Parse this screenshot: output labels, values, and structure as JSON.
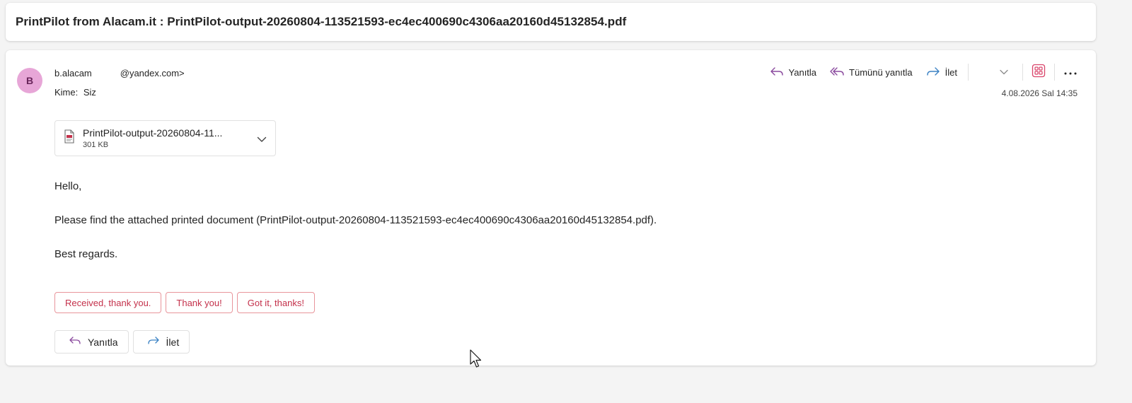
{
  "subject": "PrintPilot from Alacam.it : PrintPilot-output-20260804-113521593-ec4ec400690c4306aa20160d45132854.pdf",
  "sender": {
    "avatar_initial": "B",
    "name_part": "b.alacam",
    "email_part": "@yandex.com>"
  },
  "recipient": {
    "label": "Kime:",
    "value": "Siz"
  },
  "date": "4.08.2026 Sal 14:35",
  "actions": {
    "reply": "Yanıtla",
    "reply_all": "Tümünü yanıtla",
    "forward": "İlet"
  },
  "attachment": {
    "name": "PrintPilot-output-20260804-11...",
    "size": "301 KB"
  },
  "body": {
    "greeting": "Hello,",
    "line1": "Please find the attached printed document (PrintPilot-output-20260804-113521593-ec4ec400690c4306aa20160d45132854.pdf).",
    "closing": "Best regards."
  },
  "quick_replies": [
    "Received, thank you.",
    "Thank you!",
    "Got it, thanks!"
  ],
  "bottom_actions": {
    "reply": "Yanıtla",
    "forward": "İlet"
  },
  "colors": {
    "accent_purple": "#8a4a9e",
    "accent_blue": "#3b82c4",
    "avatar_bg": "#e7a6d7",
    "quick_reply_border": "#e8959b",
    "quick_reply_text": "#c4314b",
    "app_icon": "#d9446a"
  },
  "icons": {
    "reply": "reply-arrow-icon",
    "reply_all": "reply-all-arrow-icon",
    "forward": "forward-arrow-icon",
    "dropdown": "chevron-down-icon",
    "apps": "apps-grid-icon",
    "more": "more-dots-icon",
    "pdf": "pdf-file-icon",
    "cursor": "mouse-pointer-icon"
  }
}
